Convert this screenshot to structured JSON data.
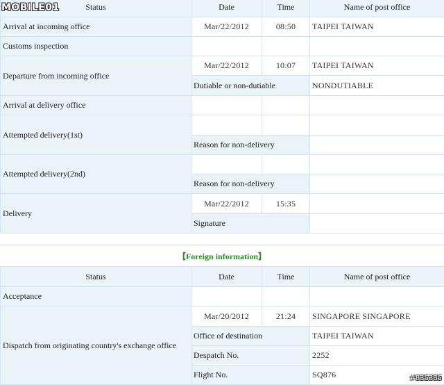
{
  "logo": {
    "text": "MOBILE01"
  },
  "watermark": "#835385",
  "domestic": {
    "headers": {
      "status": "Status",
      "date": "Date",
      "time": "Time",
      "office": "Name of post office"
    },
    "rows": {
      "arrival_incoming": {
        "status": "Arrival at incoming office",
        "date": "Mar/22/2012",
        "time": "08:50",
        "office": "TAIPEI  TAIWAN"
      },
      "customs": {
        "status": "Customs inspection"
      },
      "departure_incoming": {
        "status": "Departure from incoming office",
        "date": "Mar/22/2012",
        "time": "10:07",
        "office": "TAIPEI  TAIWAN",
        "sub_label": "Dutiable or non-dutiable",
        "sub_value": "NONDUTIABLE"
      },
      "arrival_delivery": {
        "status": "Arrival at delivery office"
      },
      "attempt1": {
        "status": "Attempted delivery(1st)",
        "sub_label": "Reason for non-delivery"
      },
      "attempt2": {
        "status": "Attempted delivery(2nd)",
        "sub_label": "Reason for non-delivery"
      },
      "delivery": {
        "status": "Delivery",
        "date": "Mar/22/2012",
        "time": "15:35",
        "sub_label": "Signature"
      }
    }
  },
  "foreign": {
    "section_title": "【Foreign information】",
    "headers": {
      "status": "Status",
      "date": "Date",
      "time": "Time",
      "office": "Name of post office"
    },
    "rows": {
      "acceptance": {
        "status": "Acceptance"
      },
      "dispatch": {
        "status": "Dispatch from originating country's exchange office",
        "date": "Mar/20/2012",
        "time": "21:24",
        "office": "SINGAPORE  SINGAPORE",
        "dest_label": "Office of destination",
        "dest_value": "TAIPEI TAIWAN",
        "despatch_label": "Despatch No.",
        "despatch_value": "2252",
        "flight_label": "Flight No.",
        "flight_value": "SQ876"
      }
    }
  }
}
